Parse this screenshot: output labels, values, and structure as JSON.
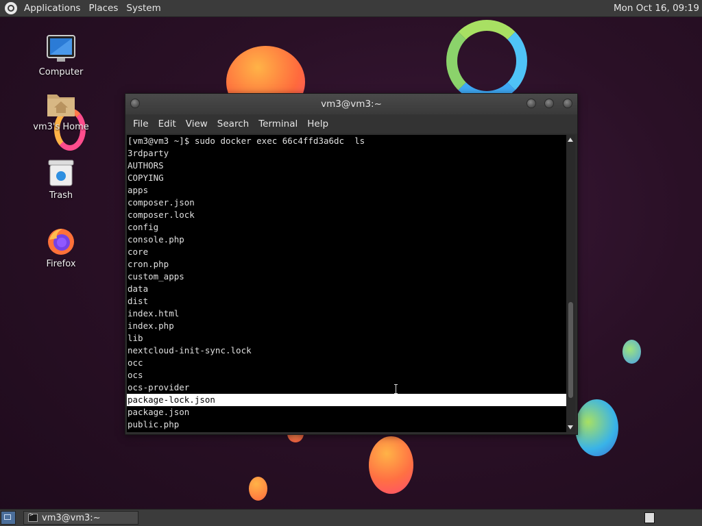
{
  "top_panel": {
    "menus": [
      "Applications",
      "Places",
      "System"
    ],
    "clock": "Mon Oct 16, 09:19"
  },
  "desktop": {
    "icons": [
      {
        "label": "Computer",
        "icon": "computer-icon"
      },
      {
        "label": "vm3's Home",
        "icon": "home-folder-icon"
      },
      {
        "label": "Trash",
        "icon": "trash-icon"
      },
      {
        "label": "Firefox",
        "icon": "firefox-icon"
      }
    ]
  },
  "terminal": {
    "title": "vm3@vm3:~",
    "menus": [
      "File",
      "Edit",
      "View",
      "Search",
      "Terminal",
      "Help"
    ],
    "lines": [
      "[vm3@vm3 ~]$ sudo docker exec 66c4ffd3a6dc  ls",
      "3rdparty",
      "AUTHORS",
      "COPYING",
      "apps",
      "composer.json",
      "composer.lock",
      "config",
      "console.php",
      "core",
      "cron.php",
      "custom_apps",
      "data",
      "dist",
      "index.html",
      "index.php",
      "lib",
      "nextcloud-init-sync.lock",
      "occ",
      "ocs",
      "ocs-provider",
      "package-lock.json",
      "package.json",
      "public.php"
    ],
    "selected_line": "package-lock.json"
  },
  "taskbar": {
    "task_label": "vm3@vm3:~"
  }
}
